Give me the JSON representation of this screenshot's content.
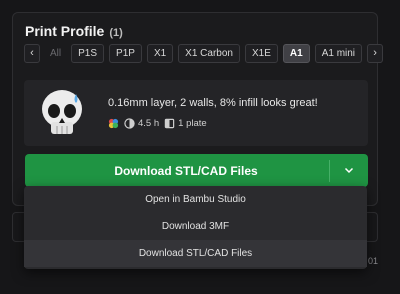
{
  "profile": {
    "title": "Print Profile",
    "count": "(1)"
  },
  "printers": {
    "prev_icon": "chevron-left-icon",
    "next_icon": "chevron-right-icon",
    "items": [
      {
        "label": "All",
        "state": "disabled"
      },
      {
        "label": "P1S",
        "state": "normal"
      },
      {
        "label": "P1P",
        "state": "normal"
      },
      {
        "label": "X1",
        "state": "normal"
      },
      {
        "label": "X1 Carbon",
        "state": "normal"
      },
      {
        "label": "X1E",
        "state": "normal"
      },
      {
        "label": "A1",
        "state": "active"
      },
      {
        "label": "A1 mini",
        "state": "normal"
      }
    ]
  },
  "profile_card": {
    "thumbnail_icon": "skull-icon",
    "description": "0.16mm layer, 2 walls, 8% infill looks great!",
    "print_time": "4.5 h",
    "plates": "1 plate"
  },
  "download": {
    "main_label": "Download STL/CAD Files",
    "caret_icon": "chevron-down-icon",
    "accent": "#1f9443"
  },
  "menu": {
    "items": [
      {
        "label": "Open in Bambu Studio"
      },
      {
        "label": "Download 3MF"
      },
      {
        "label": "Download STL/CAD Files"
      }
    ]
  },
  "background_text": "01"
}
